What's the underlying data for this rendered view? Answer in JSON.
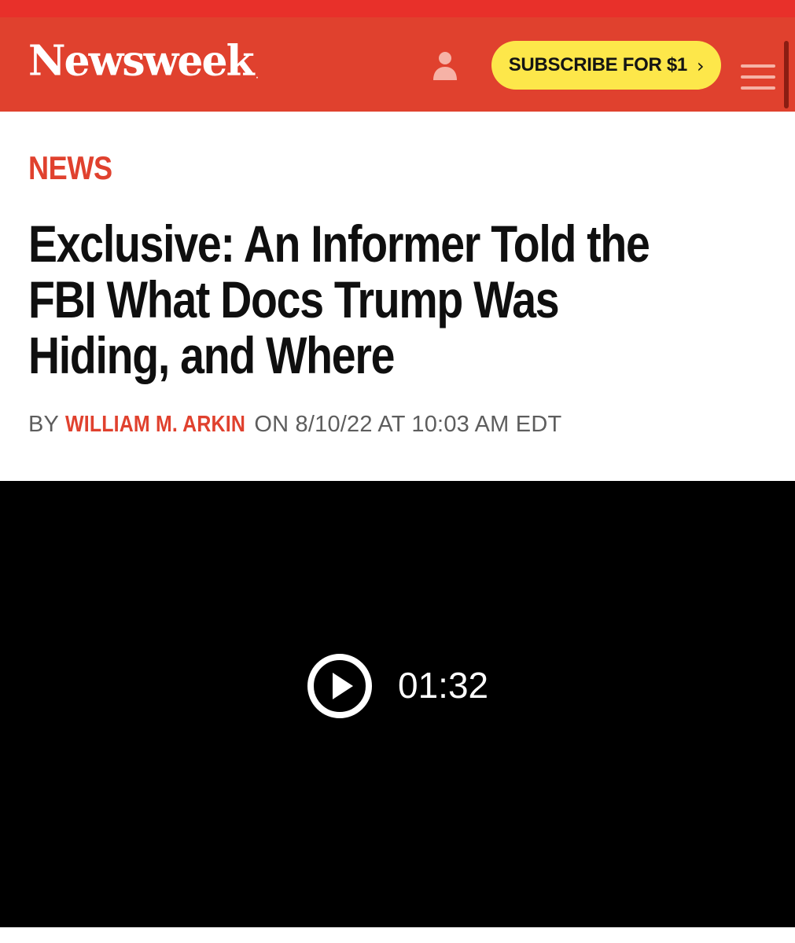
{
  "header": {
    "logo_text": "Newsweek",
    "logo_mark": ".",
    "subscribe_label": "SUBSCRIBE FOR $1",
    "subscribe_chevron": "›",
    "icons": [
      "user-icon",
      "hamburger-menu-icon"
    ]
  },
  "article": {
    "category": "NEWS",
    "headline_lines": [
      "Exclusive: An Informer Told the",
      "FBI What Docs Trump Was",
      "Hiding, and Where"
    ],
    "byline": {
      "prefix": "BY",
      "author": "WILLIAM M. ARKIN",
      "date_text": "ON 8/10/22 AT 10:03 AM EDT"
    }
  },
  "video": {
    "duration": "01:32",
    "icons": [
      "play-icon"
    ]
  },
  "colors": {
    "brand_red": "#e0412e",
    "top_strip_red": "#e8302a",
    "subscribe_yellow": "#fde74a",
    "headline_text": "#0f0f0f",
    "byline_gray": "#5d5d5d",
    "video_bg": "#000000"
  }
}
